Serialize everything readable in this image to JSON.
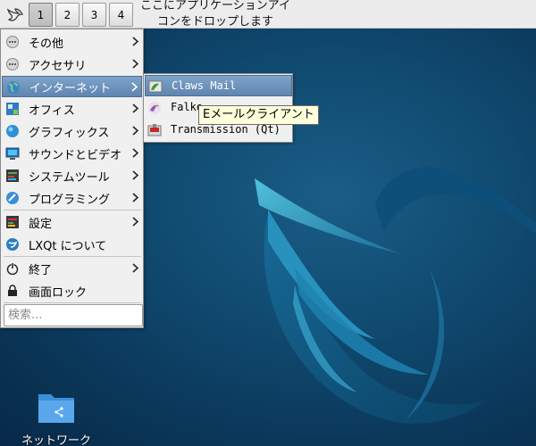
{
  "panel": {
    "workspaces": [
      "1",
      "2",
      "3",
      "4"
    ],
    "active_workspace": "1",
    "quicklaunch_hint": "ここにアプリケーションアイコンをドロップします",
    "menu_icon": "lxqt-bird-icon"
  },
  "main_menu": {
    "items": [
      {
        "label": "その他",
        "icon": "other-icon",
        "submenu": true
      },
      {
        "label": "アクセサリ",
        "icon": "accessories-icon",
        "submenu": true
      },
      {
        "label": "インターネット",
        "icon": "internet-globe-icon",
        "submenu": true,
        "highlighted": true
      },
      {
        "label": "オフィス",
        "icon": "office-icon",
        "submenu": true
      },
      {
        "label": "グラフィックス",
        "icon": "graphics-icon",
        "submenu": true
      },
      {
        "label": "サウンドとビデオ",
        "icon": "multimedia-icon",
        "submenu": true
      },
      {
        "label": "システムツール",
        "icon": "system-tools-icon",
        "submenu": true
      },
      {
        "label": "プログラミング",
        "icon": "programming-icon",
        "submenu": true
      },
      {
        "label": "設定",
        "icon": "settings-icon",
        "submenu": true
      },
      {
        "label": "LXQt について",
        "icon": "lxqt-about-icon",
        "submenu": false
      },
      {
        "label": "終了",
        "icon": "power-icon",
        "submenu": true
      },
      {
        "label": "画面ロック",
        "icon": "lock-icon",
        "submenu": false
      }
    ],
    "search_placeholder": "検索..."
  },
  "sub_menu": {
    "items": [
      {
        "label": "Claws Mail",
        "icon": "claws-mail-icon",
        "highlighted": true
      },
      {
        "label": "Falko",
        "icon": "falkon-icon"
      },
      {
        "label": "Transmission (Qt)",
        "icon": "transmission-icon"
      }
    ]
  },
  "tooltip": {
    "text": "Eメールクライアント"
  },
  "desktop": {
    "icons": [
      {
        "label": "ネットワーク",
        "icon": "network-folder-icon"
      }
    ]
  },
  "colors": {
    "highlight": "#6f95bd",
    "desktop_bg": "#0b3a5c",
    "menu_bg": "#f0f0f0",
    "tooltip_bg": "#ffffdc"
  }
}
